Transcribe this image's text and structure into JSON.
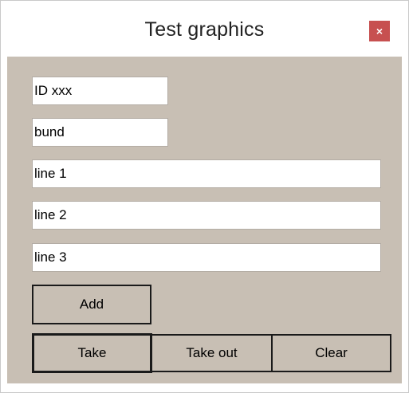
{
  "window": {
    "title": "Test graphics",
    "close_glyph": "×"
  },
  "form": {
    "id_field": "ID xxx",
    "bund_field": "bund",
    "line1": "line 1",
    "line2": "line 2",
    "line3": "line 3"
  },
  "buttons": {
    "add": "Add",
    "take": "Take",
    "take_out": "Take out",
    "clear": "Clear"
  },
  "colors": {
    "client_bg": "#c8bfb4",
    "close_button": "#c75050"
  }
}
